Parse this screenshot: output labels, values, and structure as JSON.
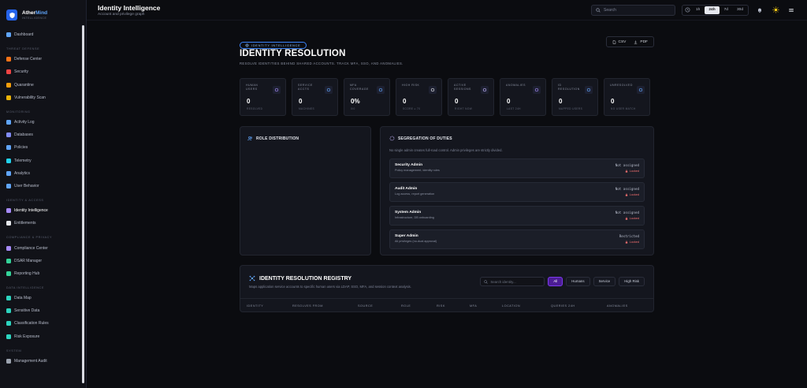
{
  "brand": {
    "name_a": "Ather",
    "name_b": "Mind",
    "sub": "INTELLIGENCE"
  },
  "nav": {
    "dashboard": "Dashboard",
    "sections": [
      {
        "title": "Threat Defense",
        "items": [
          "Defense Center",
          "Security",
          "Quarantine",
          "Vulnerability Scan"
        ]
      },
      {
        "title": "Monitoring",
        "items": [
          "Activity Log",
          "Databases",
          "Policies",
          "Telemetry",
          "Analytics",
          "User Behavior"
        ]
      },
      {
        "title": "Identity & Access",
        "items": [
          "Identity Intelligence",
          "Entitlements"
        ]
      },
      {
        "title": "Compliance & Privacy",
        "items": [
          "Compliance Center",
          "DSAR Manager",
          "Reporting Hub"
        ]
      },
      {
        "title": "Data Intelligence",
        "items": [
          "Data Map",
          "Sensitive Data",
          "Classification Rules",
          "Risk Exposure"
        ]
      },
      {
        "title": "System",
        "items": [
          "Management Audit"
        ]
      }
    ]
  },
  "header": {
    "title": "Identity Intelligence",
    "subtitle": "Account and privilege graph"
  },
  "search": {
    "placeholder": "Search"
  },
  "time_ranges": [
    "1h",
    "24h",
    "7d",
    "30d"
  ],
  "time_active": "24h",
  "page": {
    "badge": "IDENTITY INTELLIGENCE",
    "title": "IDENTITY RESOLUTION",
    "subtitle": "RESOLVE IDENTITIES BEHIND SHARED ACCOUNTS. TRACK MFA, SSO, AND ANOMALIES.",
    "export_csv": "CSV",
    "export_pdf": "PDF"
  },
  "stats": [
    {
      "label": "HUMAN USERS",
      "value": "0",
      "sub": "RESOLVED"
    },
    {
      "label": "SERVICE ACCTS",
      "value": "0",
      "sub": "MACHINES"
    },
    {
      "label": "MFA COVERAGE",
      "value": "0%",
      "sub": "0/0"
    },
    {
      "label": "HIGH RISK",
      "value": "0",
      "sub": "SCORE ≥ 70"
    },
    {
      "label": "ACTIVE SESSIONS",
      "value": "0",
      "sub": "RIGHT NOW"
    },
    {
      "label": "ANOMALIES",
      "value": "0",
      "sub": "LAST 24H"
    },
    {
      "label": "ID RESOLUTION",
      "value": "0",
      "sub": "MAPPED USERS"
    },
    {
      "label": "UNRESOLVED",
      "value": "0",
      "sub": "NO USER MATCH"
    }
  ],
  "role_panel": {
    "title": "ROLE DISTRIBUTION"
  },
  "sod": {
    "title": "SEGREGATION OF DUTIES",
    "desc": "No single admin creates full-road control. Admin privileges are strictly divided.",
    "rows": [
      {
        "name": "Security Admin",
        "desc": "Policy management, identity rules",
        "status": "Not assigned",
        "lock": "Locked"
      },
      {
        "name": "Audit Admin",
        "desc": "Log access, report generation",
        "status": "Not assigned",
        "lock": "Locked"
      },
      {
        "name": "System Admin",
        "desc": "Infrastructure, DB onboarding",
        "status": "Not assigned",
        "lock": "Locked"
      },
      {
        "name": "Super Admin",
        "desc": "All privileges (no-dual approval)",
        "status": "Restricted",
        "lock": "Locked"
      }
    ]
  },
  "registry": {
    "title": "IDENTITY RESOLUTION REGISTRY",
    "subtitle": "Maps application service accounts to specific human users via LDAP, SSO, MFA, and session context analysis.",
    "search_placeholder": "Search identity...",
    "filters": [
      "All",
      "Humans",
      "Service",
      "High Risk"
    ],
    "active_filter": "All",
    "columns": [
      "IDENTITY",
      "RESOLVES FROM",
      "SOURCE",
      "ROLE",
      "RISK",
      "MFA",
      "LOCATION",
      "QUERIES 24H",
      "ANOMALIES"
    ]
  },
  "colors": {
    "accent": "#3b82f6",
    "active_filter": "#4c1d95",
    "locked": "#f87171"
  }
}
